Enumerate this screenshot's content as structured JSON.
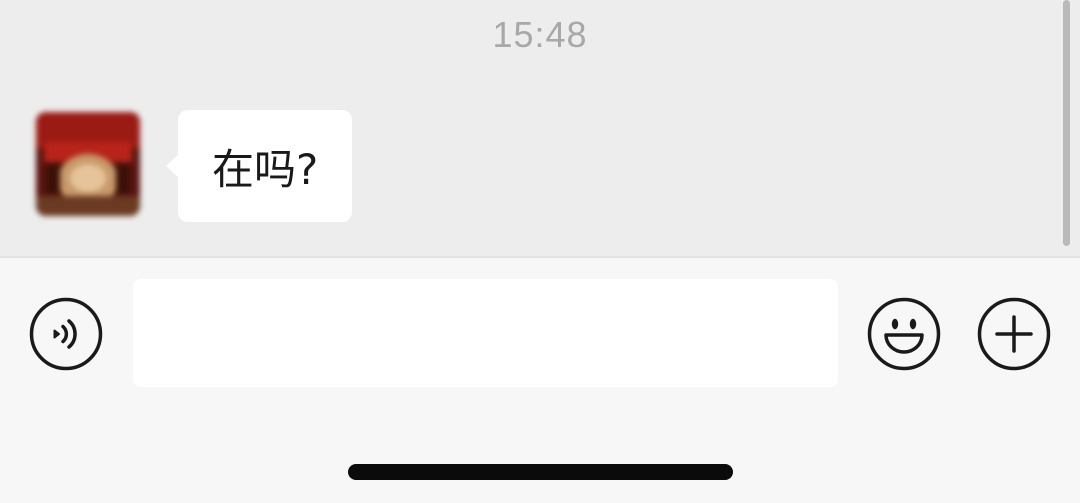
{
  "chat": {
    "timestamp": "15:48",
    "messages": [
      {
        "direction": "incoming",
        "text": "在吗?"
      }
    ]
  },
  "input_bar": {
    "text_value": "",
    "icons": {
      "voice": "voice-input-icon",
      "emoji": "emoji-icon",
      "more": "plus-icon"
    }
  },
  "colors": {
    "chat_background": "#ededed",
    "input_bar_background": "#f7f7f7",
    "bubble": "#ffffff",
    "timestamp": "#a8a8a8",
    "icon_stroke": "#1a1a1a"
  }
}
